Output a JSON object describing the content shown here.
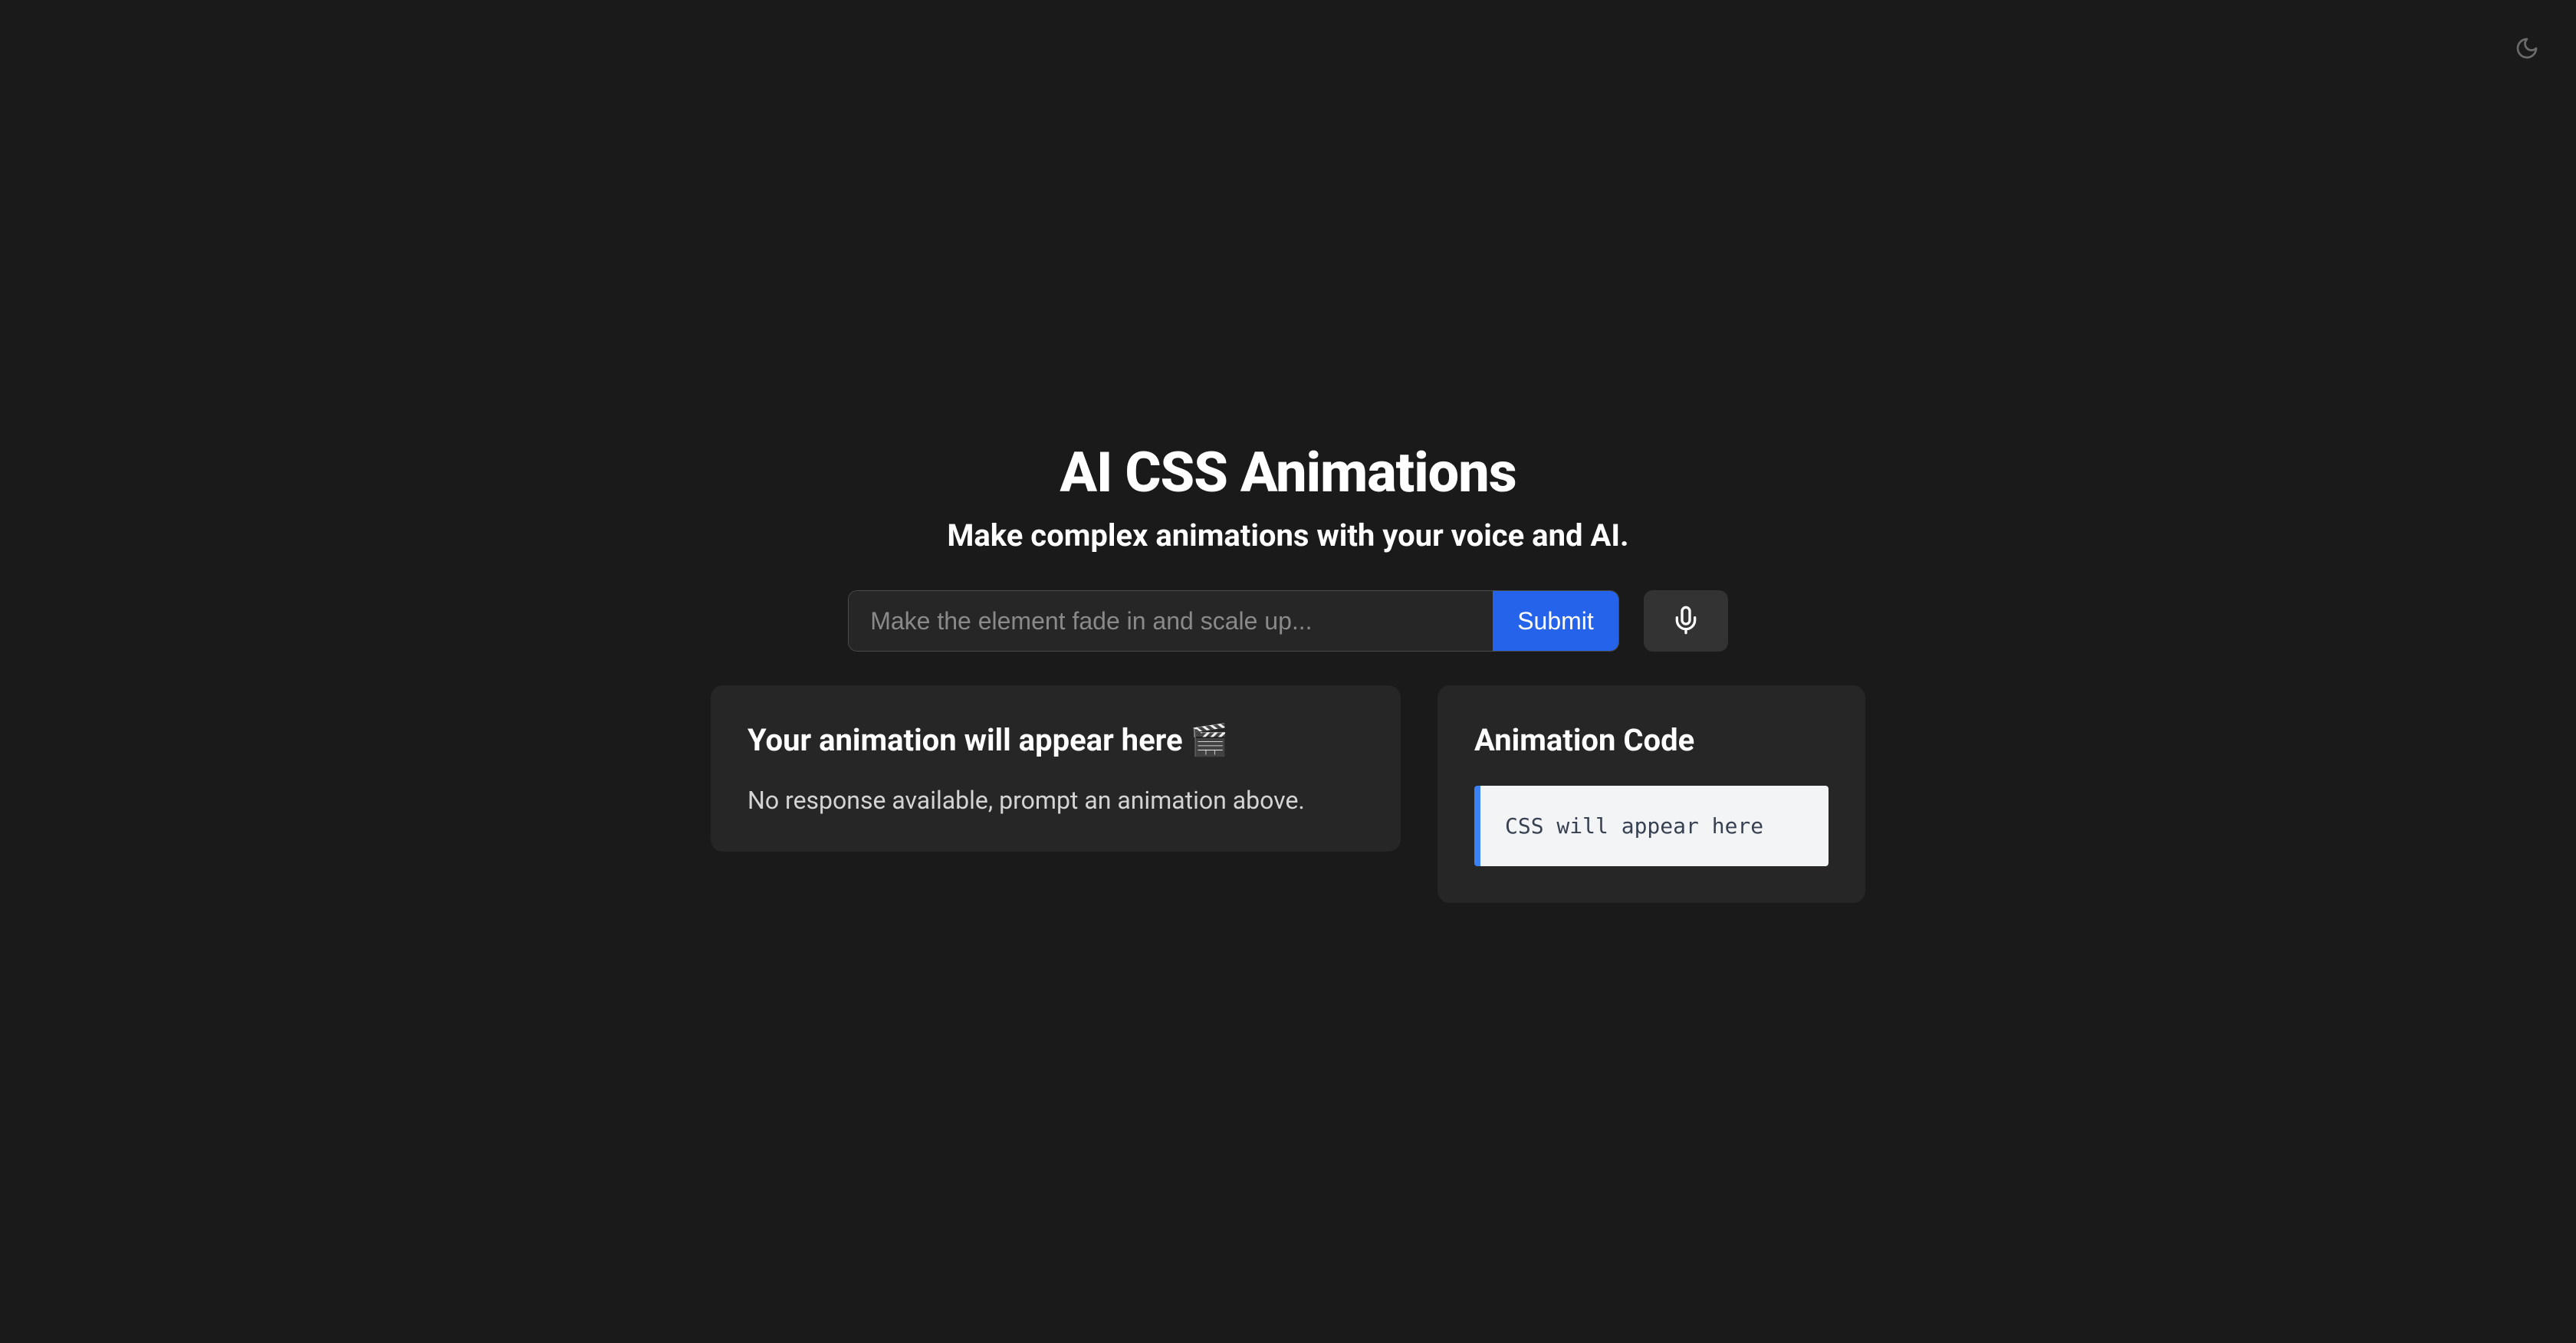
{
  "header": {
    "title": "AI CSS Animations",
    "subtitle": "Make complex animations with your voice and AI."
  },
  "prompt": {
    "placeholder": "Make the element fade in and scale up...",
    "value": "",
    "submit_label": "Submit"
  },
  "preview": {
    "title": "Your animation will appear here 🎬",
    "empty_text": "No response available, prompt an animation above."
  },
  "code": {
    "title": "Animation Code",
    "placeholder": "CSS will appear here"
  }
}
